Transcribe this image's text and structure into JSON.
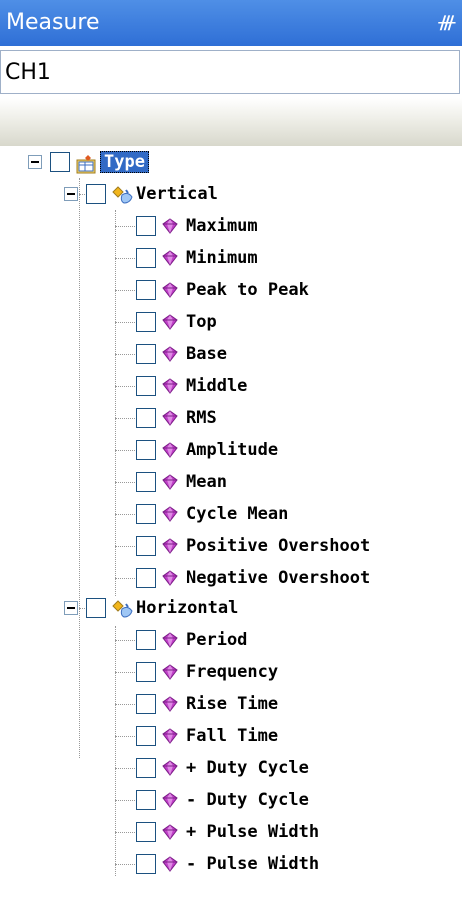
{
  "panel": {
    "title": "Measure",
    "pin_icon": "pin-icon"
  },
  "channel_select": {
    "value": "CH1"
  },
  "tree": {
    "root": {
      "label": "Type",
      "icon": "folder-table-icon"
    },
    "groups": [
      {
        "label": "Vertical",
        "icon": "measure-group-icon",
        "items": [
          "Maximum",
          "Minimum",
          "Peak to Peak",
          "Top",
          "Base",
          "Middle",
          "RMS",
          "Amplitude",
          "Mean",
          "Cycle Mean",
          "Positive Overshoot",
          "Negative Overshoot"
        ]
      },
      {
        "label": "Horizontal",
        "icon": "measure-group-icon",
        "items": [
          "Period",
          "Frequency",
          "Rise Time",
          "Fall Time",
          "+ Duty Cycle",
          "- Duty Cycle",
          "+ Pulse Width",
          "- Pulse Width"
        ]
      }
    ]
  },
  "colors": {
    "title_bar": "#2f6fd6",
    "selection": "#316ac5",
    "gem": "#c040c8"
  }
}
